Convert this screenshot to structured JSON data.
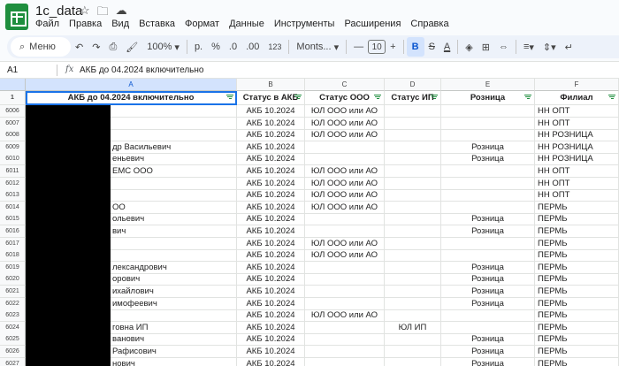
{
  "doc": {
    "title": "1с_data",
    "menu": [
      "Файл",
      "Правка",
      "Вид",
      "Вставка",
      "Формат",
      "Данные",
      "Инструменты",
      "Расширения",
      "Справка"
    ]
  },
  "toolbar": {
    "menu_search": "Меню",
    "zoom": "100%",
    "currency": "р.",
    "percent": "%",
    "decimal_decrease": ".0",
    "decimal_increase": ".00",
    "number_format": "123",
    "font": "Monts...",
    "font_size": "10",
    "bold": "B",
    "text_color": "A"
  },
  "formula_bar": {
    "cell_ref": "A1",
    "fx": "fx",
    "content": "АКБ до 04.2024 включительно"
  },
  "columns": [
    "A",
    "B",
    "C",
    "D",
    "E",
    "F"
  ],
  "header_row_number": "1",
  "headers": [
    "АКБ до 04.2024 включительно",
    "Статус в АКБ",
    "Статус ООО",
    "Статус ИП",
    "Розница",
    "Филиал"
  ],
  "rows": [
    {
      "n": "6006",
      "a": "",
      "b": "АКБ 10.2024",
      "c": "ЮЛ ООО или АО",
      "d": "",
      "e": "",
      "f": "НН ОПТ"
    },
    {
      "n": "6007",
      "a": "",
      "b": "АКБ 10.2024",
      "c": "ЮЛ ООО или АО",
      "d": "",
      "e": "",
      "f": "НН ОПТ"
    },
    {
      "n": "6008",
      "a": "",
      "b": "АКБ 10.2024",
      "c": "ЮЛ ООО или АО",
      "d": "",
      "e": "",
      "f": "НН РОЗНИЦА"
    },
    {
      "n": "6009",
      "a": "др Васильевич",
      "b": "АКБ 10.2024",
      "c": "",
      "d": "",
      "e": "Розница",
      "f": "НН РОЗНИЦА"
    },
    {
      "n": "6010",
      "a": "еньевич",
      "b": "АКБ 10.2024",
      "c": "",
      "d": "",
      "e": "Розница",
      "f": "НН РОЗНИЦА"
    },
    {
      "n": "6011",
      "a": "ЕМС ООО",
      "b": "АКБ 10.2024",
      "c": "ЮЛ ООО или АО",
      "d": "",
      "e": "",
      "f": "НН ОПТ"
    },
    {
      "n": "6012",
      "a": "",
      "b": "АКБ 10.2024",
      "c": "ЮЛ ООО или АО",
      "d": "",
      "e": "",
      "f": "НН ОПТ"
    },
    {
      "n": "6013",
      "a": "",
      "b": "АКБ 10.2024",
      "c": "ЮЛ ООО или АО",
      "d": "",
      "e": "",
      "f": "НН ОПТ"
    },
    {
      "n": "6014",
      "a": "ОО",
      "b": "АКБ 10.2024",
      "c": "ЮЛ ООО или АО",
      "d": "",
      "e": "",
      "f": "ПЕРМЬ"
    },
    {
      "n": "6015",
      "a": "ольевич",
      "b": "АКБ 10.2024",
      "c": "",
      "d": "",
      "e": "Розница",
      "f": "ПЕРМЬ"
    },
    {
      "n": "6016",
      "a": "вич",
      "b": "АКБ 10.2024",
      "c": "",
      "d": "",
      "e": "Розница",
      "f": "ПЕРМЬ"
    },
    {
      "n": "6017",
      "a": "",
      "b": "АКБ 10.2024",
      "c": "ЮЛ ООО или АО",
      "d": "",
      "e": "",
      "f": "ПЕРМЬ"
    },
    {
      "n": "6018",
      "a": "",
      "b": "АКБ 10.2024",
      "c": "ЮЛ ООО или АО",
      "d": "",
      "e": "",
      "f": "ПЕРМЬ"
    },
    {
      "n": "6019",
      "a": "лександрович",
      "b": "АКБ 10.2024",
      "c": "",
      "d": "",
      "e": "Розница",
      "f": "ПЕРМЬ"
    },
    {
      "n": "6020",
      "a": "орович",
      "b": "АКБ 10.2024",
      "c": "",
      "d": "",
      "e": "Розница",
      "f": "ПЕРМЬ"
    },
    {
      "n": "6021",
      "a": "ихайлович",
      "b": "АКБ 10.2024",
      "c": "",
      "d": "",
      "e": "Розница",
      "f": "ПЕРМЬ"
    },
    {
      "n": "6022",
      "a": "имофеевич",
      "b": "АКБ 10.2024",
      "c": "",
      "d": "",
      "e": "Розница",
      "f": "ПЕРМЬ"
    },
    {
      "n": "6023",
      "a": "",
      "b": "АКБ 10.2024",
      "c": "ЮЛ ООО или АО",
      "d": "",
      "e": "",
      "f": "ПЕРМЬ"
    },
    {
      "n": "6024",
      "a": "говна ИП",
      "b": "АКБ 10.2024",
      "c": "",
      "d": "ЮЛ ИП",
      "e": "",
      "f": "ПЕРМЬ"
    },
    {
      "n": "6025",
      "a": "ванович",
      "b": "АКБ 10.2024",
      "c": "",
      "d": "",
      "e": "Розница",
      "f": "ПЕРМЬ"
    },
    {
      "n": "6026",
      "a": "Рафисович",
      "b": "АКБ 10.2024",
      "c": "",
      "d": "",
      "e": "Розница",
      "f": "ПЕРМЬ"
    },
    {
      "n": "6027",
      "a": "нович",
      "b": "АКБ 10.2024",
      "c": "",
      "d": "",
      "e": "Розница",
      "f": "ПЕРМЬ"
    }
  ]
}
